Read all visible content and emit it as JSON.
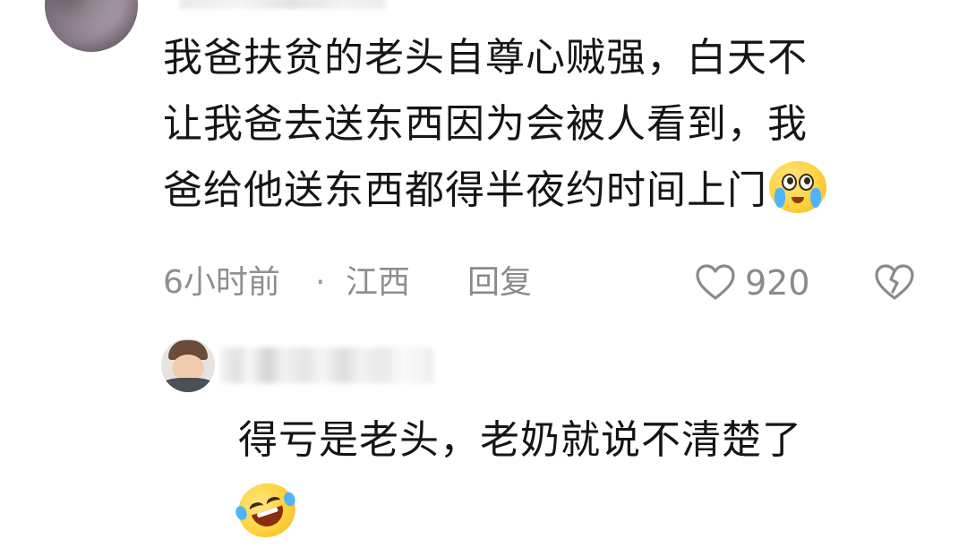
{
  "comment": {
    "lines": [
      "我爸扶贫的老头自尊心贼强，白天不",
      "让我爸去送东西因为会被人看到，我",
      "爸给他送东西都得半夜约时间上门"
    ],
    "emoji": "touched-crying-emoji",
    "time": "6小时前",
    "separator": "·",
    "location": "江西",
    "reply_label": "回复",
    "like_count": "920"
  },
  "reply": {
    "text": "得亏是老头，老奶就说不清楚了",
    "emoji": "rolling-laughing-emoji"
  },
  "colors": {
    "text": "#151515",
    "meta": "#8f8f8f",
    "background": "#ffffff"
  }
}
